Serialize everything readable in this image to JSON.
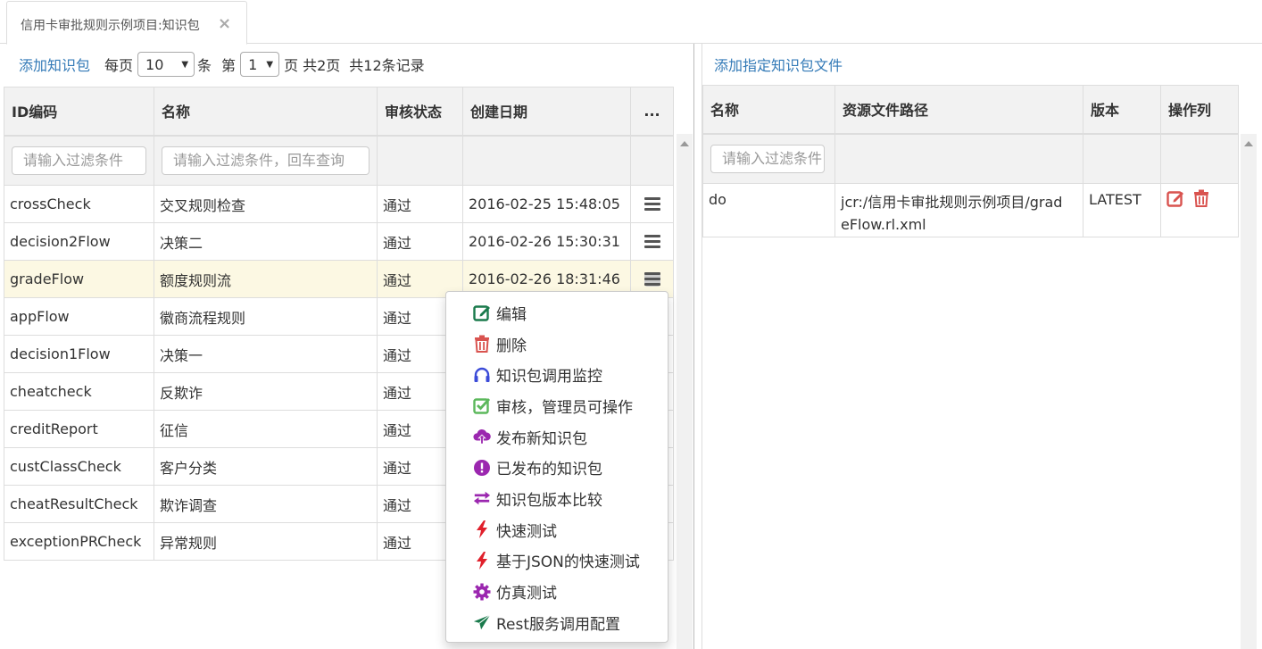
{
  "tab": {
    "title": "信用卡审批规则示例项目:知识包",
    "close": "×"
  },
  "left": {
    "add_link": "添加知识包",
    "pager": {
      "per_page_prefix": "每页",
      "per_page_value": "10",
      "per_page_suffix": "条",
      "page_prefix": "第",
      "page_value": "1",
      "page_suffix": "页",
      "total_pages": "共2页",
      "total_records": "共12条记录"
    },
    "columns": [
      "ID编码",
      "名称",
      "审核状态",
      "创建日期",
      "..."
    ],
    "filter_placeholders": {
      "id": "请输入过滤条件",
      "name": "请输入过滤条件，回车查询"
    },
    "rows": [
      {
        "id": "crossCheck",
        "name": "交叉规则检查",
        "status": "通过",
        "date": "2016-02-25 15:48:05"
      },
      {
        "id": "decision2Flow",
        "name": "决策二",
        "status": "通过",
        "date": "2016-02-26 15:30:31"
      },
      {
        "id": "gradeFlow",
        "name": "额度规则流",
        "status": "通过",
        "date": "2016-02-26 18:31:46"
      },
      {
        "id": "appFlow",
        "name": "徽商流程规则",
        "status": "通过",
        "date": ""
      },
      {
        "id": "decision1Flow",
        "name": "决策一",
        "status": "通过",
        "date": ""
      },
      {
        "id": "cheatcheck",
        "name": "反欺诈",
        "status": "通过",
        "date": ""
      },
      {
        "id": "creditReport",
        "name": "征信",
        "status": "通过",
        "date": ""
      },
      {
        "id": "custClassCheck",
        "name": "客户分类",
        "status": "通过",
        "date": ""
      },
      {
        "id": "cheatResultCheck",
        "name": "欺诈调查",
        "status": "通过",
        "date": ""
      },
      {
        "id": "exceptionPRCheck",
        "name": "异常规则",
        "status": "通过",
        "date": ""
      }
    ]
  },
  "menu": {
    "items": [
      {
        "label": "编辑",
        "icon": "edit-icon",
        "color": "#1a7a4c"
      },
      {
        "label": "删除",
        "icon": "trash-icon",
        "color": "#d9534f"
      },
      {
        "label": "知识包调用监控",
        "icon": "headphones-icon",
        "color": "#3b4bd8"
      },
      {
        "label": "审核，管理员可操作",
        "icon": "check-square-icon",
        "color": "#5cb85c"
      },
      {
        "label": "发布新知识包",
        "icon": "cloud-upload-icon",
        "color": "#9b27af"
      },
      {
        "label": "已发布的知识包",
        "icon": "exclamation-circle-icon",
        "color": "#9b27af"
      },
      {
        "label": "知识包版本比较",
        "icon": "exchange-icon",
        "color": "#9b27af"
      },
      {
        "label": "快速测试",
        "icon": "bolt-icon",
        "color": "#e0202b"
      },
      {
        "label": "基于JSON的快速测试",
        "icon": "bolt-icon",
        "color": "#e0202b"
      },
      {
        "label": "仿真测试",
        "icon": "cog-icon",
        "color": "#9b27af"
      },
      {
        "label": "Rest服务调用配置",
        "icon": "send-icon",
        "color": "#1a7a4c"
      }
    ]
  },
  "right": {
    "add_link": "添加指定知识包文件",
    "columns": [
      "名称",
      "资源文件路径",
      "版本",
      "操作列"
    ],
    "filter_placeholder": "请输入过滤条件",
    "rows": [
      {
        "name": "do",
        "path_line1": "jcr:/信用卡审批规则示例项目/grad",
        "path_line2": "eFlow.rl.xml",
        "version": "LATEST"
      }
    ]
  }
}
